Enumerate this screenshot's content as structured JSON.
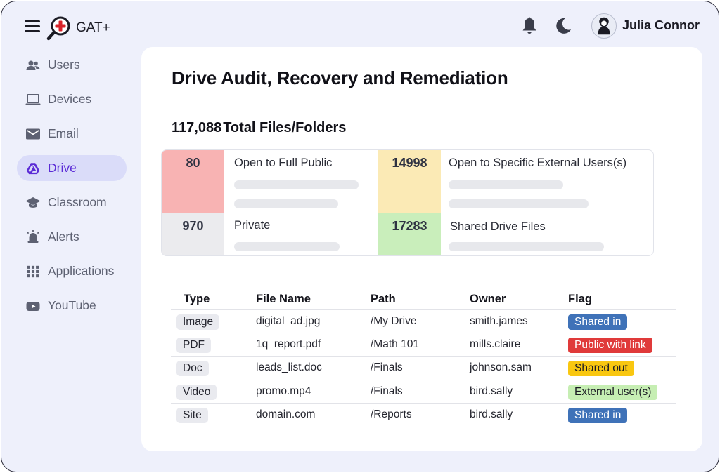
{
  "app": {
    "brand": "GAT+"
  },
  "header": {
    "user_name": "Julia Connor"
  },
  "sidebar": {
    "items": [
      {
        "label": "Users",
        "icon": "users-icon"
      },
      {
        "label": "Devices",
        "icon": "laptop-icon"
      },
      {
        "label": "Email",
        "icon": "mail-icon"
      },
      {
        "label": "Drive",
        "icon": "drive-icon",
        "active": true
      },
      {
        "label": "Classroom",
        "icon": "graduation-cap-icon"
      },
      {
        "label": "Alerts",
        "icon": "alarm-icon"
      },
      {
        "label": "Applications",
        "icon": "grid-icon"
      },
      {
        "label": "YouTube",
        "icon": "youtube-icon"
      }
    ]
  },
  "main": {
    "title": "Drive Audit, Recovery and Remediation",
    "total_count": "117,088",
    "total_label": "Total Files/Folders",
    "summary": [
      {
        "count": "80",
        "label": "Open to Full Public",
        "color": "#f8b3b3"
      },
      {
        "count": "14998",
        "label": "Open to Specific External Users(s)",
        "color": "#fbeab5"
      },
      {
        "count": "970",
        "label": "Private",
        "color": "#ebebee"
      },
      {
        "count": "17283",
        "label": "Shared Drive Files",
        "color": "#c9eebb"
      }
    ],
    "table": {
      "headers": [
        "Type",
        "File Name",
        "Path",
        "Owner",
        "Flag"
      ],
      "rows": [
        {
          "type": "Image",
          "file": "digital_ad.jpg",
          "path": "/My Drive",
          "owner": "smith.james",
          "flag": "Shared in"
        },
        {
          "type": "PDF",
          "file": "1q_report.pdf",
          "path": "/Math 101",
          "owner": "mills.claire",
          "flag": "Public with link"
        },
        {
          "type": "Doc",
          "file": "leads_list.doc",
          "path": "/Finals",
          "owner": "johnson.sam",
          "flag": "Shared out"
        },
        {
          "type": "Video",
          "file": "promo.mp4",
          "path": "/Finals",
          "owner": "bird.sally",
          "flag": "External user(s)"
        },
        {
          "type": "Site",
          "file": "domain.com",
          "path": "/Reports",
          "owner": "bird.sally",
          "flag": "Shared in"
        }
      ]
    },
    "flag_colors": {
      "Shared in": {
        "bg": "#3f72b8",
        "fg": "#ffffff"
      },
      "Public with link": {
        "bg": "#e03a3a",
        "fg": "#ffffff"
      },
      "Shared out": {
        "bg": "#f9c710",
        "fg": "#1b1b24"
      },
      "External user(s)": {
        "bg": "#c6eeb3",
        "fg": "#1b1b24"
      }
    }
  }
}
